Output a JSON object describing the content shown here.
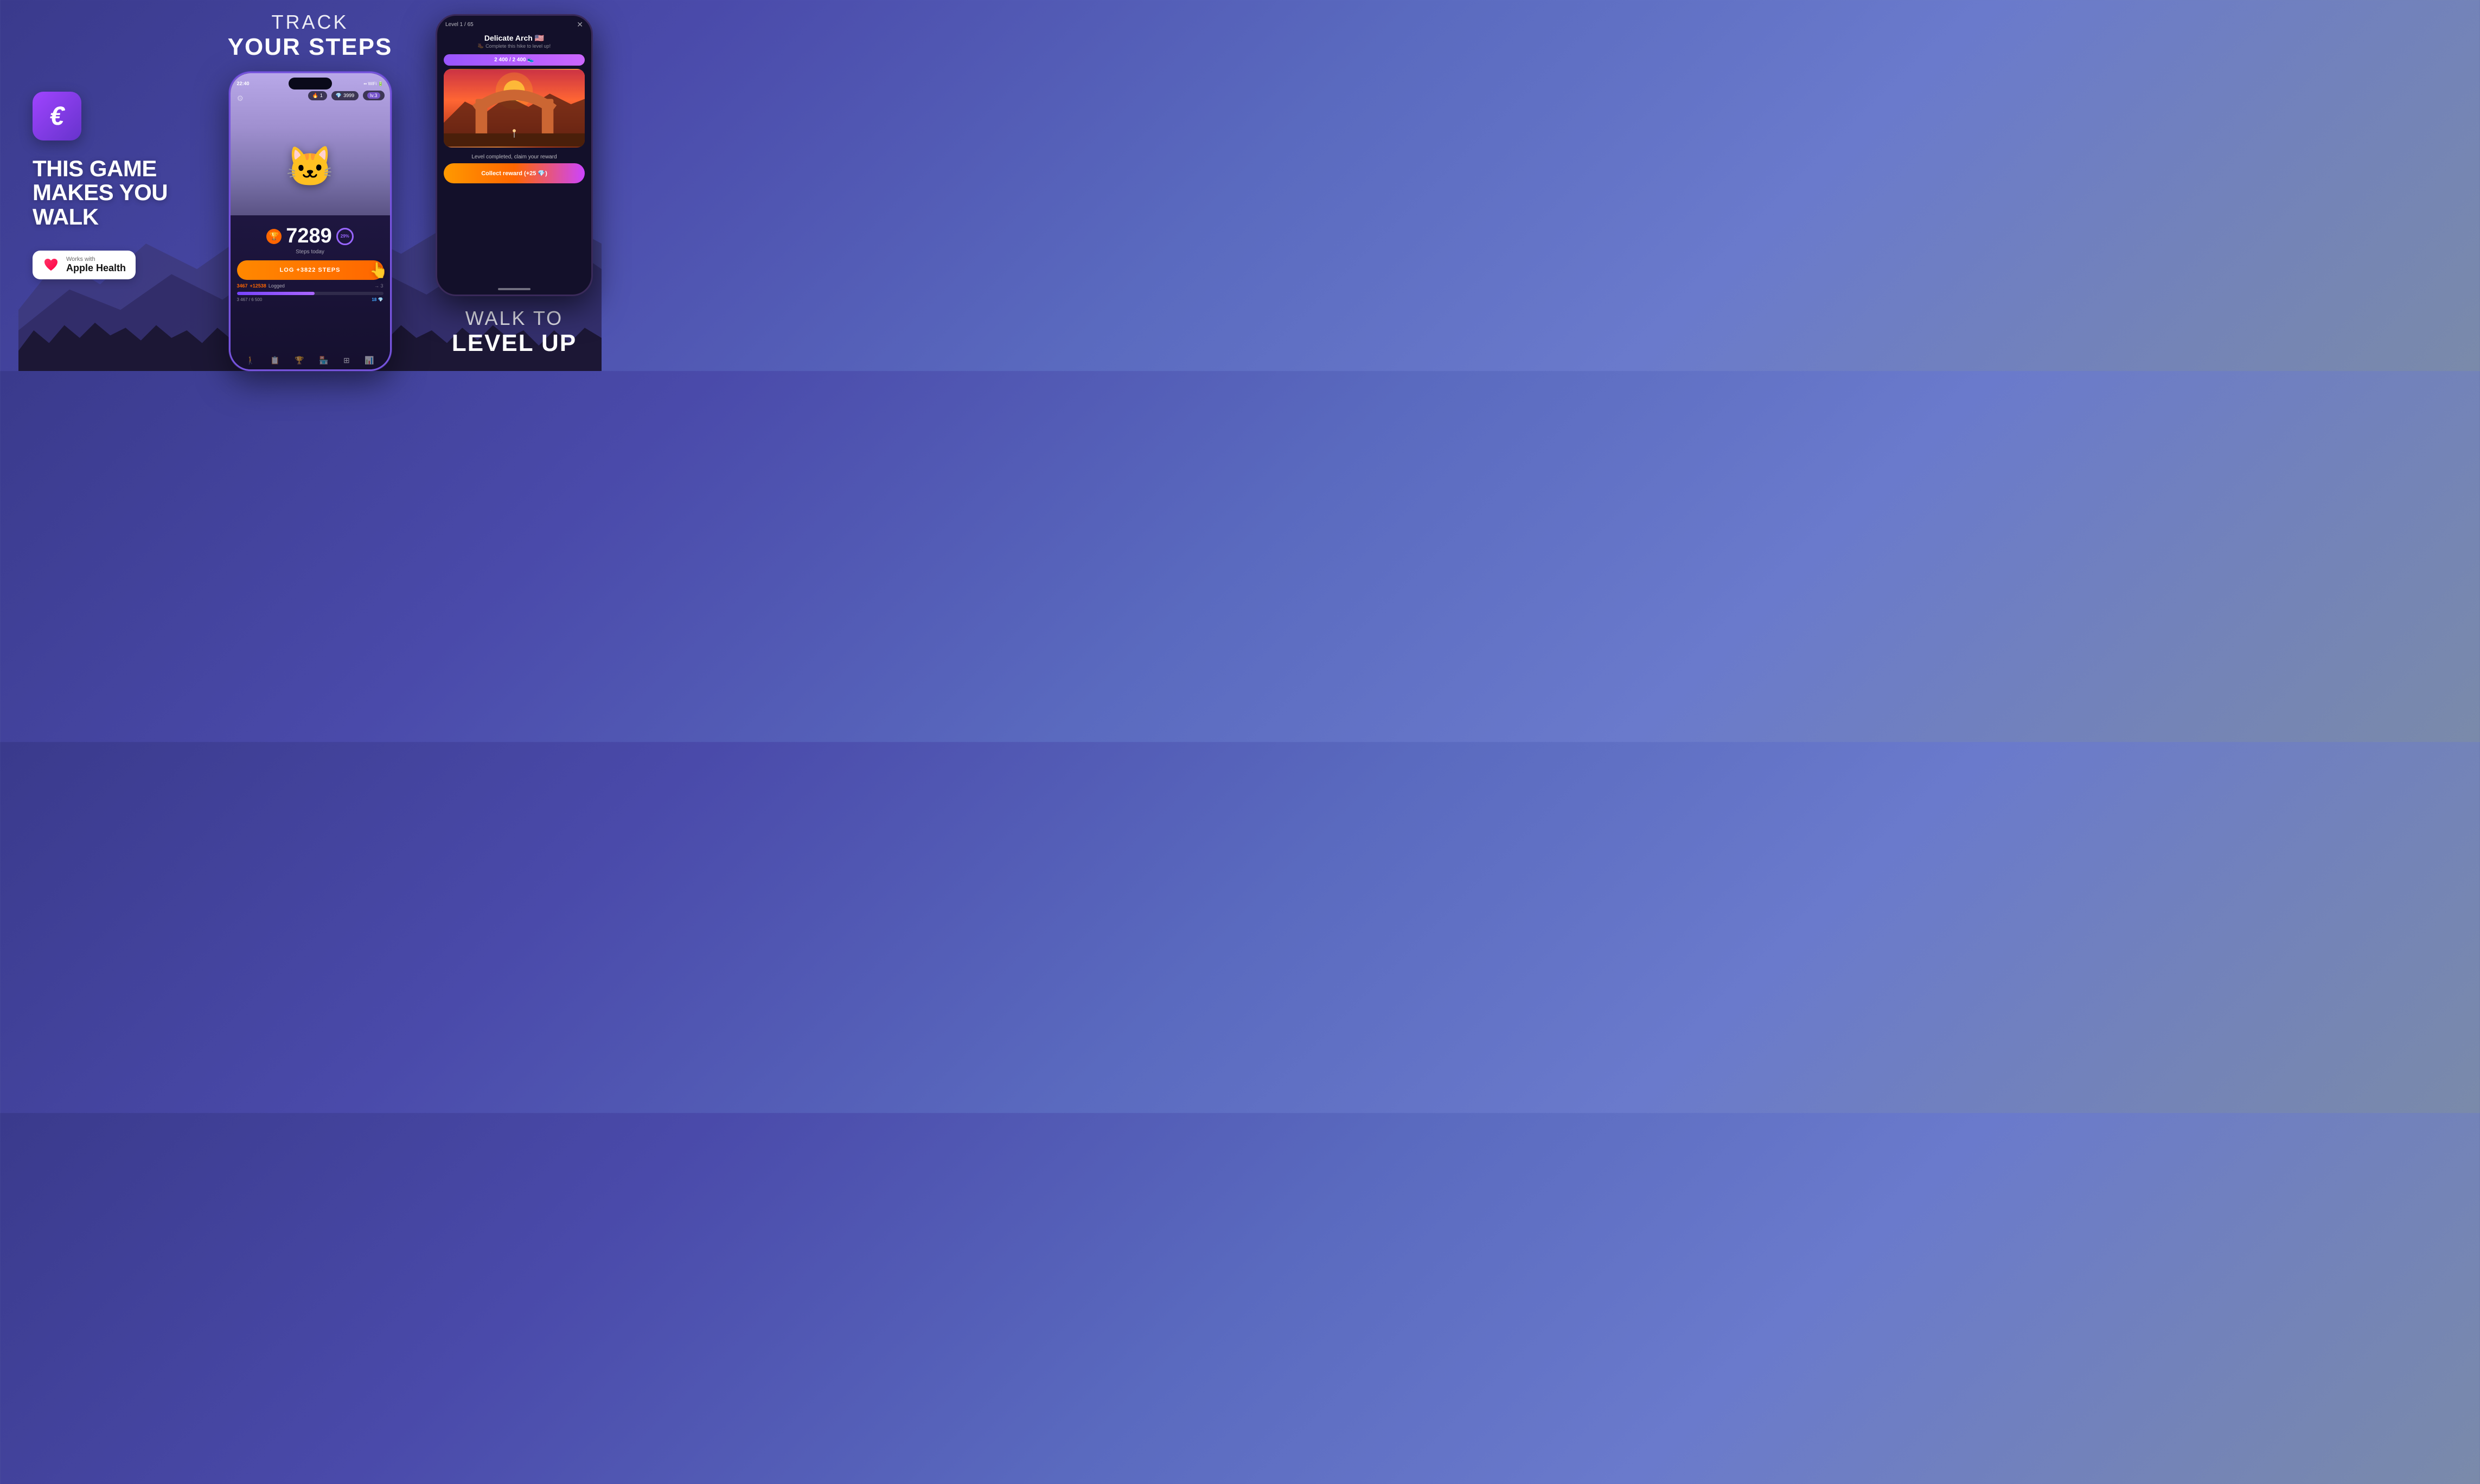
{
  "background": {
    "gradient_start": "#3a3a8c",
    "gradient_end": "#7a8aaa"
  },
  "app_icon": {
    "letter": "€",
    "bg_gradient_start": "#a044ff",
    "bg_gradient_end": "#6633cc"
  },
  "left": {
    "tagline_line1": "THIS GAME",
    "tagline_line2": "MAKES YOU",
    "tagline_line3": "WALK",
    "apple_health": {
      "works_with": "Works with",
      "label": "Apple Health"
    }
  },
  "center": {
    "heading_line1": "TRACK",
    "heading_line2": "YOUR STEPS",
    "phone": {
      "time": "22:40",
      "stat_flame": "1",
      "stat_gems": "3999",
      "stat_level": "lv.3",
      "steps_today": "7289",
      "steps_label": "Steps today",
      "steps_percent": "29%",
      "log_button": "LOG +3822 STEPS",
      "logged_prefix": "3467",
      "logged_plus": "+12538",
      "logged_suffix": "Logged",
      "progress_start": "3 467 / 6 500",
      "progress_end": "18",
      "progress_gem": "💎"
    }
  },
  "right": {
    "walk_to": "WALK TO",
    "level_up": "LEVEL UP",
    "phone2": {
      "level_text": "Level 1 / 65",
      "location": "Delicate Arch 🇺🇸",
      "subtitle": "Complete this hike to level up!",
      "progress": "2 400 / 2 400 👟",
      "complete_text": "Level completed, claim your reward",
      "collect_button": "Collect reward (+25 💎)"
    }
  }
}
